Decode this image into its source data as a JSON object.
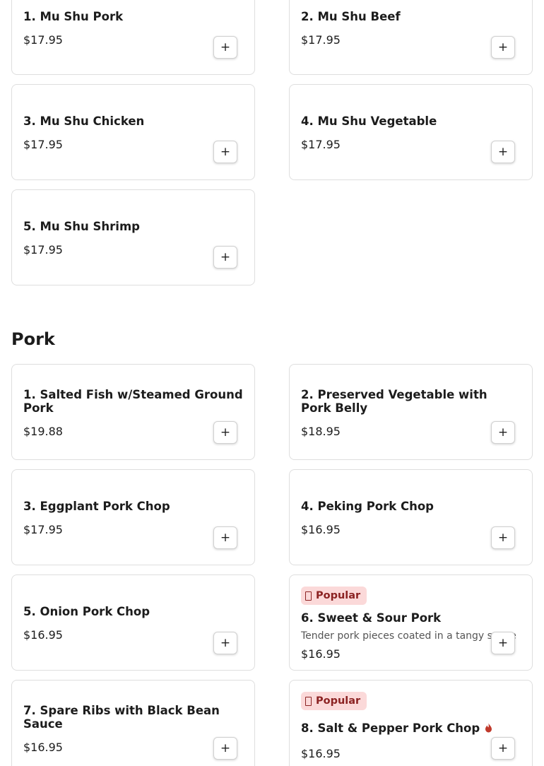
{
  "mushu": {
    "items": [
      {
        "name": "1. Mu Shu Pork",
        "price": "$17.95"
      },
      {
        "name": "2. Mu Shu Beef",
        "price": "$17.95"
      },
      {
        "name": "3. Mu Shu Chicken",
        "price": "$17.95"
      },
      {
        "name": "4. Mu Shu Vegetable",
        "price": "$17.95"
      },
      {
        "name": "5. Mu Shu Shrimp",
        "price": "$17.95"
      }
    ]
  },
  "pork": {
    "title": "Pork",
    "items": [
      {
        "name": "1. Salted Fish w/Steamed Ground Pork",
        "price": "$19.88"
      },
      {
        "name": "2. Preserved Vegetable with Pork Belly",
        "price": "$18.95"
      },
      {
        "name": "3. Eggplant Pork Chop",
        "price": "$17.95"
      },
      {
        "name": "4. Peking Pork Chop",
        "price": "$16.95"
      },
      {
        "name": "5. Onion Pork Chop",
        "price": "$16.95"
      },
      {
        "name": "6. Sweet & Sour Pork",
        "price": "$16.95",
        "badge": "Popular",
        "description": "Tender pork pieces coated in a tangy sauce"
      },
      {
        "name": "7. Spare Ribs with Black Bean Sauce",
        "price": "$16.95"
      },
      {
        "name": "8. Salt & Pepper Pork Chop",
        "price": "$16.95",
        "badge": "Popular",
        "spicy_icon": "flame-icon"
      }
    ]
  },
  "add_button_label": "+",
  "colors": {
    "badge_bg": "#fbd9d9",
    "badge_text": "#8c2323",
    "spicy": "#c0392b",
    "card_border": "#dedede"
  }
}
